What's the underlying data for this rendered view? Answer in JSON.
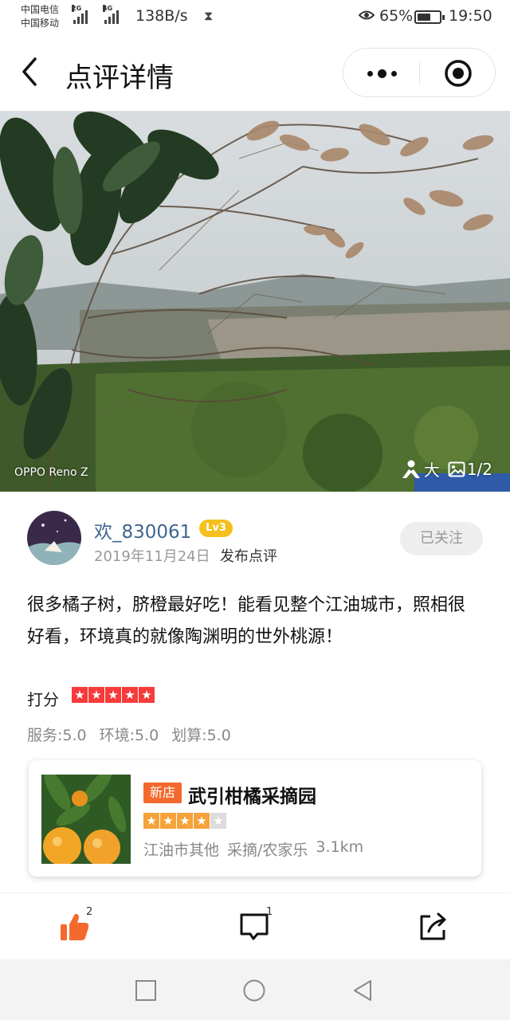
{
  "status_bar": {
    "carrier_1": "中国电信",
    "carrier_2": "中国移动",
    "signal_1_tag": "2G",
    "signal_2_tag": "4G",
    "net_speed": "138B/s",
    "battery_percent": "65%",
    "battery_level": 0.65,
    "time": "19:50"
  },
  "nav": {
    "title": "点评详情"
  },
  "photo": {
    "watermark": "OPPO Reno Z",
    "enlarge_label": "大",
    "counter": "1/2"
  },
  "author": {
    "username": "欢_830061",
    "level": "Lv3",
    "date": "2019年11月24日",
    "action": "发布点评",
    "follow_label": "已关注"
  },
  "review": {
    "text": "很多橘子树，脐橙最好吃！能看见整个江油城市，照相很好看，环境真的就像陶渊明的世外桃源！",
    "score_label": "打分",
    "rating": 5,
    "sub_scores": [
      "服务:5.0",
      "环境:5.0",
      "划算:5.0"
    ]
  },
  "shop": {
    "badge": "新店",
    "name": "武引柑橘采摘园",
    "rating": 4,
    "area": "江油市其他",
    "category": "采摘/农家乐",
    "distance": "3.1km"
  },
  "actions": {
    "like_count": "2",
    "comment_count": "1"
  },
  "colors": {
    "link_blue": "#3f6591",
    "like_orange": "#f3692d",
    "rating_red": "#f63b3b",
    "level_yellow": "#f6c01c",
    "shop_star_orange": "#f6a23a"
  }
}
